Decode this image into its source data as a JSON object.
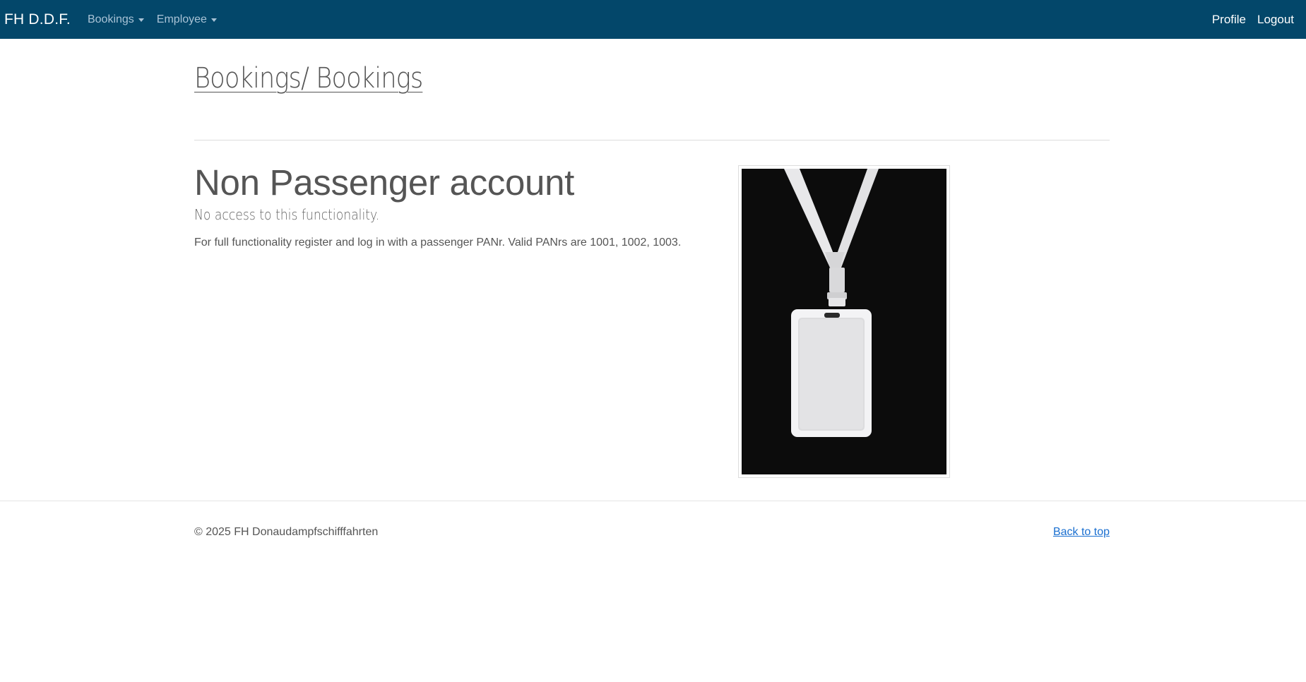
{
  "navbar": {
    "brand": "FH D.D.F.",
    "menus": [
      {
        "label": "Bookings"
      },
      {
        "label": "Employee"
      }
    ],
    "right_links": [
      {
        "label": "Profile"
      },
      {
        "label": "Logout"
      }
    ],
    "bg_color": "#03476a"
  },
  "page": {
    "breadcrumb_title": "Bookings/ Bookings"
  },
  "content": {
    "title": "Non Passenger account",
    "subtitle": "No access to this functionality.",
    "text": "For full functionality register and log in with a passenger PANr. Valid PANrs are 1001, 1002, 1003.",
    "image_icon": "lanyard-badge-photo"
  },
  "footer": {
    "copyright": "© 2025 FH Donaudampfschifffahrten",
    "back_to_top": "Back to top",
    "link_color": "#1a6fd0"
  }
}
